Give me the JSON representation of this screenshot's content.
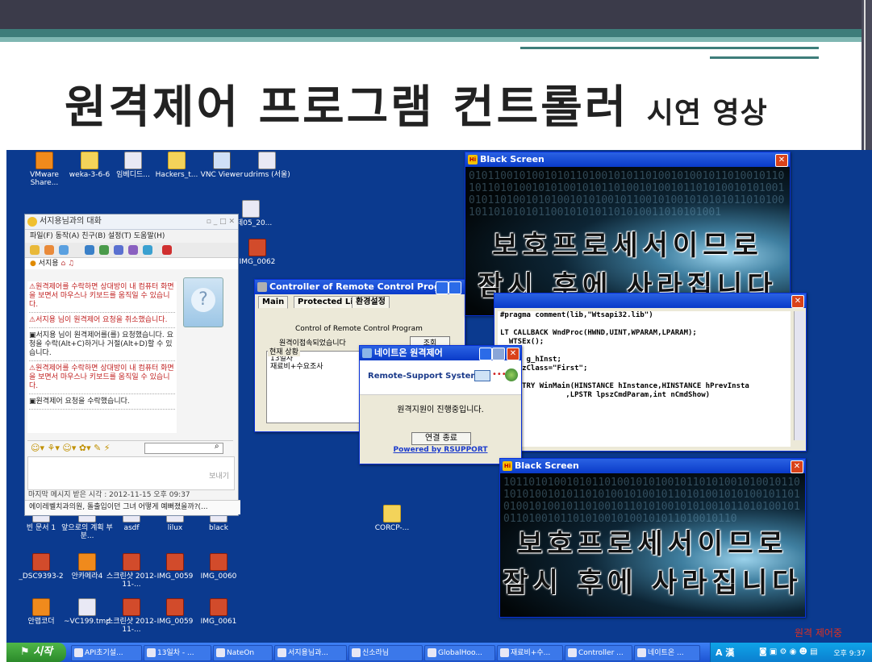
{
  "slide": {
    "title_main": "원격제어 프로그램 컨트롤러",
    "title_sub": "시연 영상"
  },
  "desktop_icons": [
    {
      "label": "VMware Share...",
      "kind": "app"
    },
    {
      "label": "weka-3-6-6",
      "kind": "folder"
    },
    {
      "label": "임베디드...",
      "kind": "doc"
    },
    {
      "label": "Hackers_t...",
      "kind": "folder"
    },
    {
      "label": "VNC Viewer",
      "kind": "win"
    },
    {
      "label": "udrims (서울)",
      "kind": "doc"
    },
    {
      "label": "과제05_20...",
      "kind": "doc"
    },
    {
      "label": "IMG_0062",
      "kind": "img"
    },
    {
      "label": "빈 문서 1",
      "kind": "doc"
    },
    {
      "label": "앞으로의 계획 부분...",
      "kind": "doc"
    },
    {
      "label": "asdf",
      "kind": "doc"
    },
    {
      "label": "lilux",
      "kind": "doc"
    },
    {
      "label": "black",
      "kind": "doc"
    },
    {
      "label": "CORCP-...",
      "kind": "folder"
    },
    {
      "label": "_DSC9393-2",
      "kind": "img"
    },
    {
      "label": "안카메라4",
      "kind": "app"
    },
    {
      "label": "스크린샷 2012-11-...",
      "kind": "img"
    },
    {
      "label": "IMG_0059",
      "kind": "img"
    },
    {
      "label": "IMG_0060",
      "kind": "img"
    },
    {
      "label": "안랩코더",
      "kind": "app"
    },
    {
      "label": "~VC199.tmp",
      "kind": "doc"
    },
    {
      "label": "스크린샷 2012-11-...",
      "kind": "img"
    },
    {
      "label": "IMG_0059",
      "kind": "img"
    },
    {
      "label": "IMG_0061",
      "kind": "img"
    }
  ],
  "chat_window": {
    "title": "서지용님과의 대화",
    "menu": "파일(F)  동작(A)  친구(B)  설정(T)  도움말(H)",
    "user": "서지용",
    "messages": [
      {
        "text": "원격제어를 수락하면 상대방이 내 컴퓨터 화면을 보면서 마우스나 키보드를 움직일 수 있습니다.",
        "style": "red"
      },
      {
        "text": "서지용 님이 원격제어 요청을 취소했습니다.",
        "style": "red"
      },
      {
        "text": "서지용 님이 원격제어를(를) 요청했습니다. 요청을 수락(Alt+C)하거나 거절(Alt+D)할 수 있습니다.",
        "style": "blue"
      },
      {
        "text": "원격제어를 수락하면 상대방이 내 컴퓨터 화면을 보면서 마우스나 키보드를 움직일 수 있습니다.",
        "style": "red"
      },
      {
        "text": "원격제어 요청을 수락했습니다.",
        "style": "blue"
      }
    ],
    "send_label": "보내기",
    "last_message": "마지막 메시지 받은 시각 : 2012-11-15 오후 09:37",
    "ad": "에이레벨치과의원, 돌출입이던 그녀 어떻게 예뻐졌을까?(..."
  },
  "controller": {
    "title": "Controller of Remote Control Program",
    "tabs": [
      "Main",
      "Protected List",
      "환경설정"
    ],
    "caption": "Control of Remote Control Program",
    "status": "원격이접속되었습니다",
    "button": "조회",
    "group_label": "현재 상황",
    "group_lines": [
      "13일차",
      "재료비+수요조사"
    ]
  },
  "remote_support": {
    "title": "네이트온 원격제어",
    "logo": "Remote-Support System",
    "message": "원격지원이 진행중입니다.",
    "button": "연결 종료",
    "link": "Powered by RSUPPORT"
  },
  "black_screen_1": {
    "title": "Black Screen",
    "line1": "보호프로세서이므로",
    "line2": "잠시 후에 사라집니다"
  },
  "black_screen_2": {
    "title": "Black Screen",
    "line1": "보호프로세서이므로",
    "line2": "잠시 후에 사라집니다"
  },
  "code_window": {
    "lines": [
      "#pragma comment(lib,\"Wtsapi32.lib\")",
      "",
      "LT CALLBACK WndProc(HWND,UINT,WPARAM,LPARAM);",
      "  WTSEx();",
      "",
      "TANCE g_hInst;",
      "R lpszClass=\"First\";",
      "",
      "APIENTRY WinMain(HINSTANCE hInstance,HINSTANCE hPrevInsta",
      "               ,LPSTR lpszCmdParam,int nCmdShow)"
    ]
  },
  "status_remote": "원격 제어중",
  "taskbar": {
    "start": "시작",
    "tasks": [
      "API초기설...",
      "13일차 - ...",
      "NateOn",
      "서지용님과...",
      "신소라님",
      "GlobalHoo...",
      "재료비+수...",
      "Controller ...",
      "네이트온 ..."
    ],
    "ime": "A 漢",
    "clock": "오후 9:37"
  },
  "colors": {
    "desktop": "#0b3a8f",
    "titlebar": "#0a3bc9",
    "slide_accent": "#3e7d7a"
  }
}
